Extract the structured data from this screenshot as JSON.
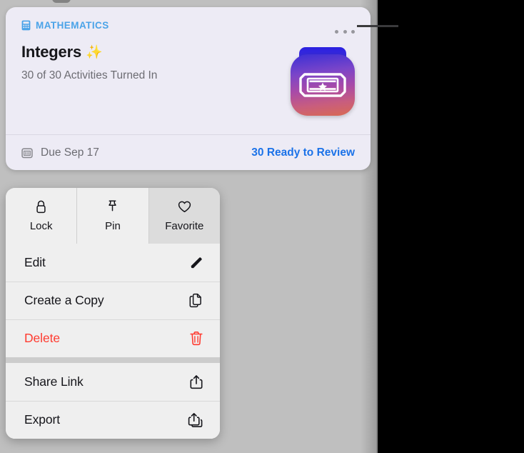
{
  "colors": {
    "page_background": "#bfbfbf",
    "card_background": "#edebf5",
    "subject_accent": "#4aa3e8",
    "link_accent": "#1b72e8",
    "destructive": "#ff3b30",
    "menu_background": "#efefef",
    "menu_separator": "#cccccc",
    "callout_line": "#3a3a3c"
  },
  "card": {
    "subject": {
      "icon": "calculator-icon",
      "label": "MATHEMATICS"
    },
    "more_button": {
      "icon": "ellipsis-icon",
      "label": "More"
    },
    "title": "Integers",
    "title_emoji": "✨",
    "subtitle": "30 of 30 Activities Turned In",
    "app_icon": {
      "name": "activity-app-icon",
      "glyph": "ticket-star-icon"
    },
    "footer": {
      "due_icon": "calendar-icon",
      "due_label": "Due Sep 17",
      "review_link": "30 Ready to Review"
    }
  },
  "context_menu": {
    "quick_actions": [
      {
        "id": "lock",
        "label": "Lock",
        "icon": "lock-icon",
        "active": false
      },
      {
        "id": "pin",
        "label": "Pin",
        "icon": "pin-icon",
        "active": false
      },
      {
        "id": "favorite",
        "label": "Favorite",
        "icon": "heart-icon",
        "active": true
      }
    ],
    "groups": [
      {
        "items": [
          {
            "id": "edit",
            "label": "Edit",
            "icon": "pencil-icon",
            "destructive": false
          },
          {
            "id": "create-a-copy",
            "label": "Create a Copy",
            "icon": "duplicate-icon",
            "destructive": false
          },
          {
            "id": "delete",
            "label": "Delete",
            "icon": "trash-icon",
            "destructive": true
          }
        ]
      },
      {
        "items": [
          {
            "id": "share-link",
            "label": "Share Link",
            "icon": "share-icon",
            "destructive": false
          },
          {
            "id": "export",
            "label": "Export",
            "icon": "export-icon",
            "destructive": false
          }
        ]
      }
    ]
  }
}
